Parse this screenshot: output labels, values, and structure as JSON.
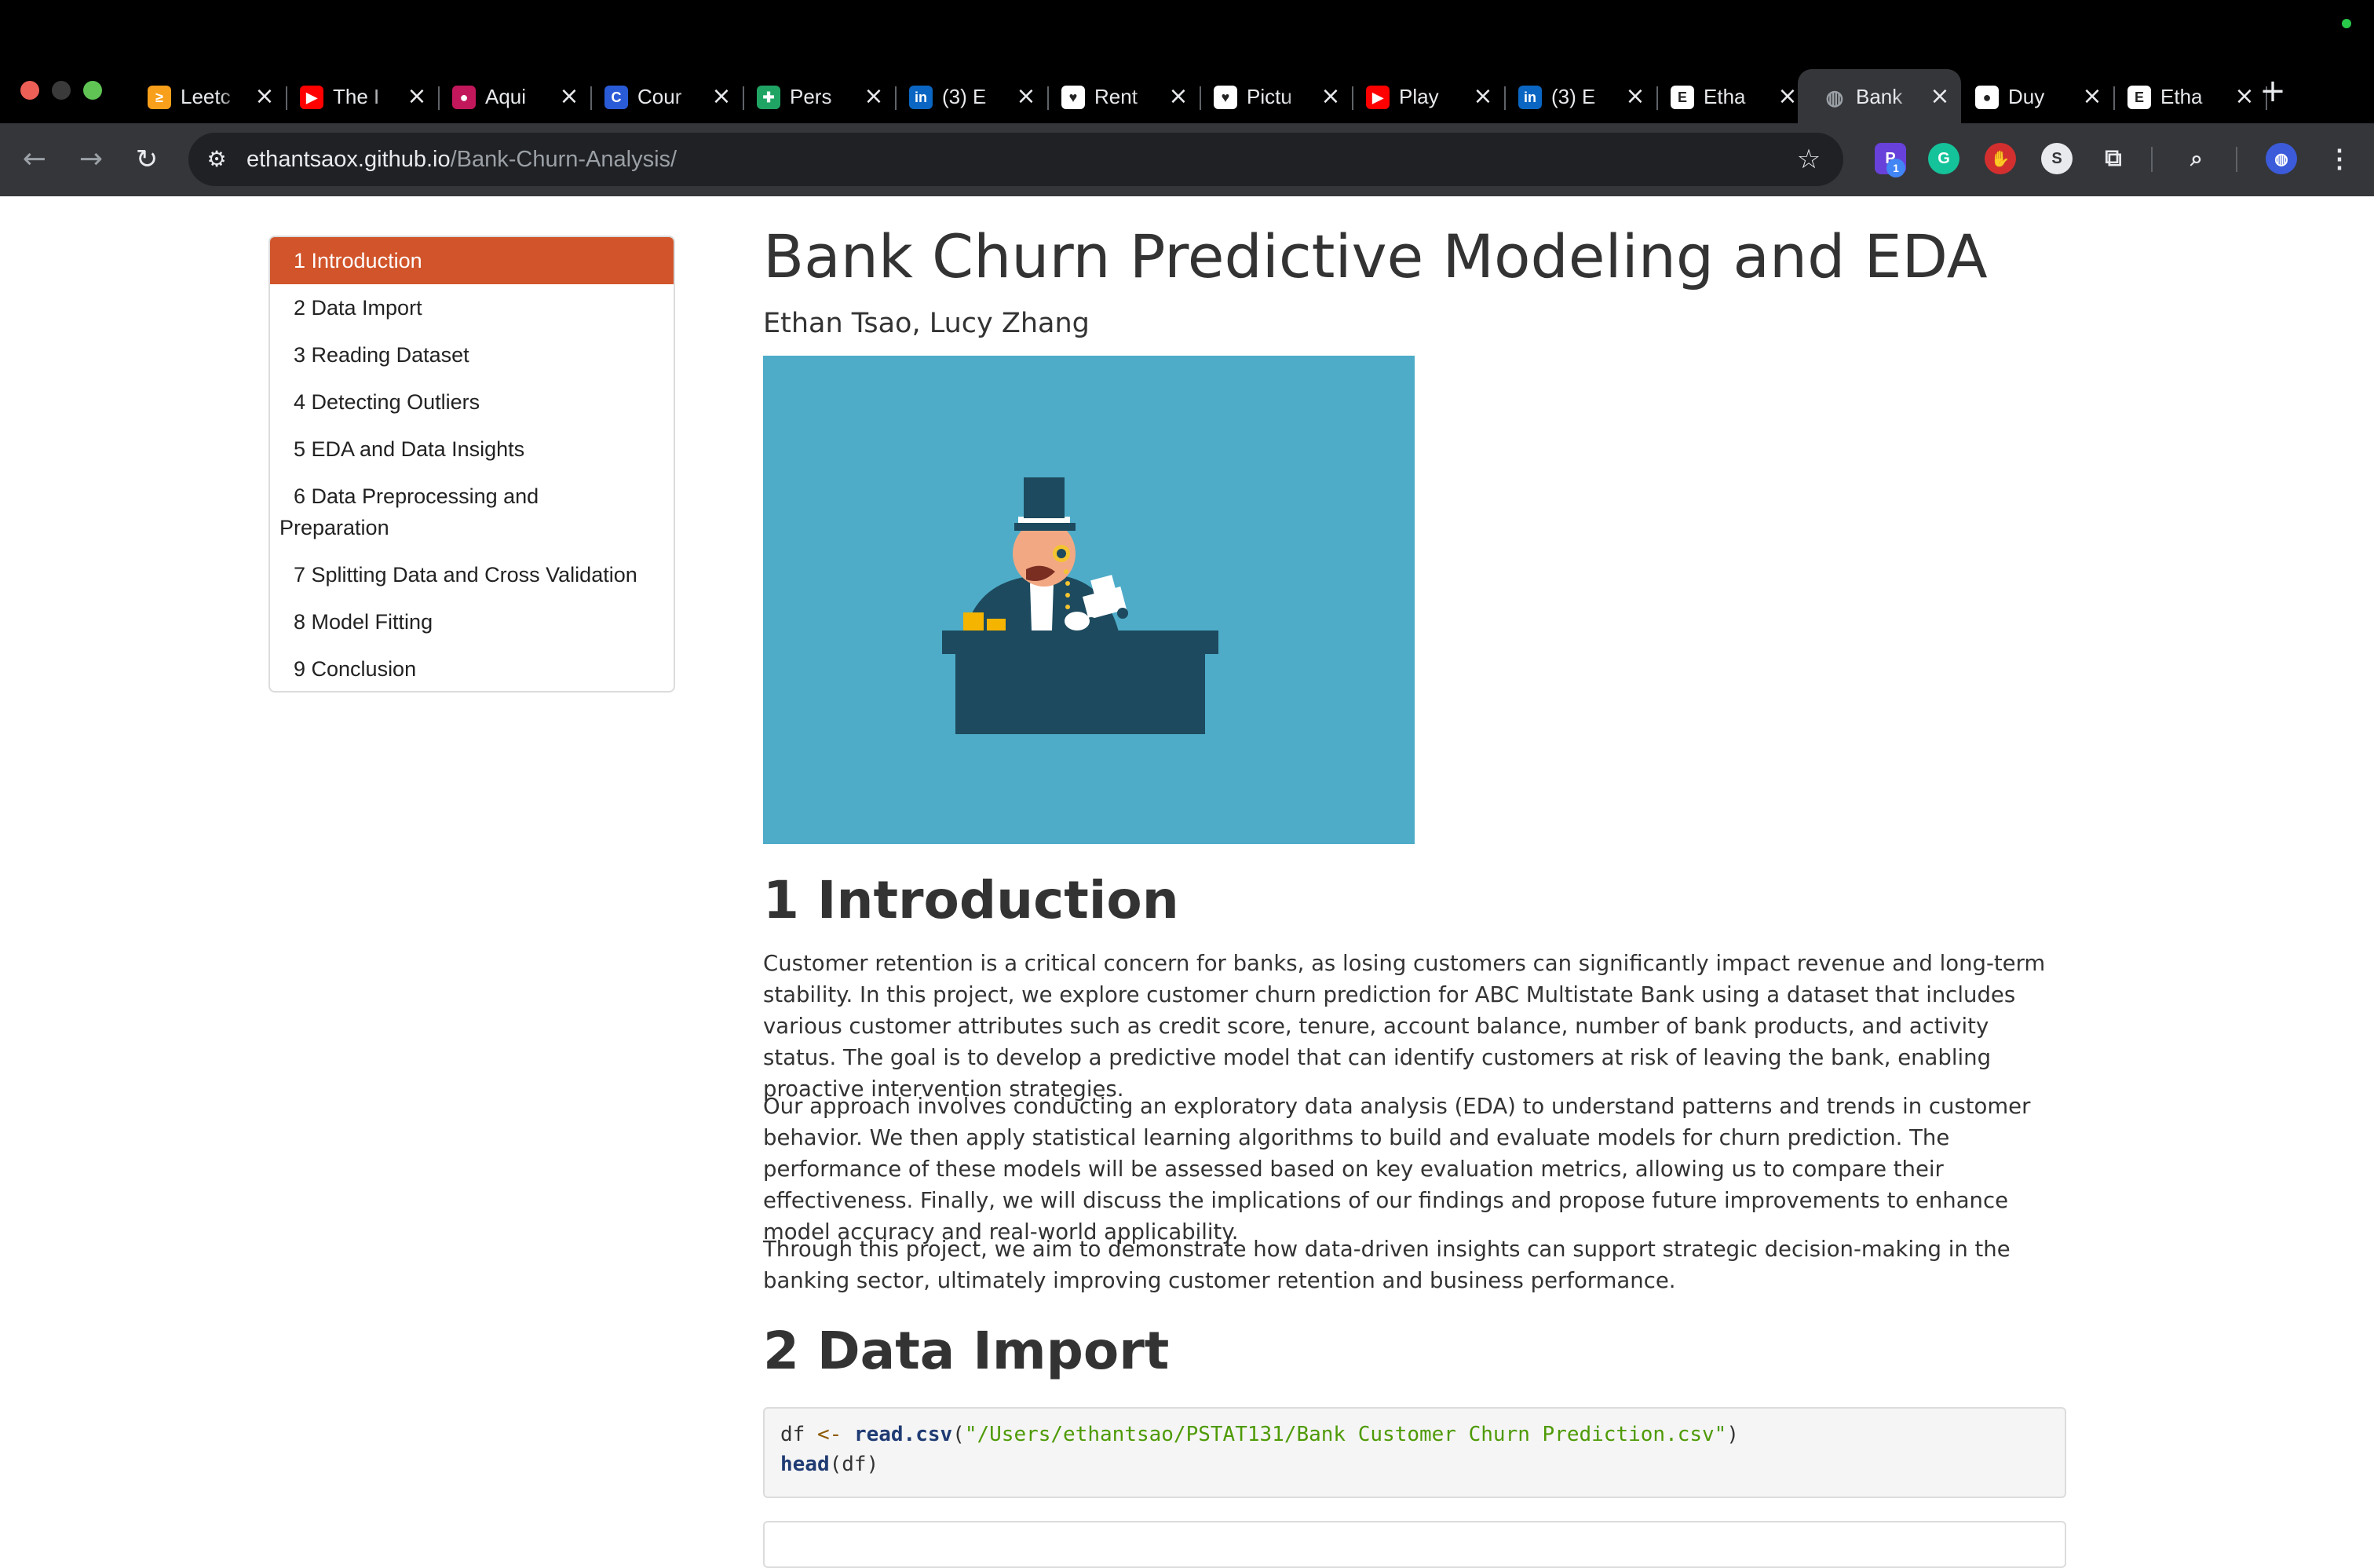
{
  "browser": {
    "tabs": [
      {
        "title": "Leetc",
        "icon": "leetcode-icon",
        "color": "#f89f1b",
        "glyph": "≥"
      },
      {
        "title": "The I",
        "icon": "youtube-icon",
        "color": "#ff0000",
        "glyph": "▶"
      },
      {
        "title": "Aqui",
        "icon": "aquila-icon",
        "color": "#c2185b",
        "glyph": "●"
      },
      {
        "title": "Cour",
        "icon": "coursera-icon",
        "color": "#2a5bd7",
        "glyph": "C"
      },
      {
        "title": "Pers",
        "icon": "sheets-icon",
        "color": "#20a464",
        "glyph": "✚"
      },
      {
        "title": "(3) E",
        "icon": "linkedin-icon",
        "color": "#0a66c2",
        "glyph": "in"
      },
      {
        "title": "Rent",
        "icon": "doc-icon",
        "color": "#ffffff",
        "glyph": "♥"
      },
      {
        "title": "Pictu",
        "icon": "doc-icon",
        "color": "#ffffff",
        "glyph": "♥"
      },
      {
        "title": "Play",
        "icon": "youtube-icon",
        "color": "#ff0000",
        "glyph": "▶"
      },
      {
        "title": "(3) E",
        "icon": "linkedin-icon",
        "color": "#0a66c2",
        "glyph": "in"
      },
      {
        "title": "Etha",
        "icon": "e-icon",
        "color": "#ffffff",
        "glyph": "E"
      },
      {
        "title": "Bank",
        "icon": "globe-icon",
        "color": "#9aa0a6",
        "glyph": "◍",
        "active": true
      },
      {
        "title": "Duy",
        "icon": "github-icon",
        "color": "#ffffff",
        "glyph": "●"
      },
      {
        "title": "Etha",
        "icon": "e-icon",
        "color": "#ffffff",
        "glyph": "E"
      }
    ],
    "url_host": "ethantsaox.github.io",
    "url_path": "/Bank-Churn-Analysis/",
    "extension_badge": "1"
  },
  "toc": {
    "items": [
      "1 Introduction",
      "2 Data Import",
      "3 Reading Dataset",
      "4 Detecting Outliers",
      "5 EDA and Data Insights",
      "6 Data Preprocessing and Preparation",
      "7 Splitting Data and Cross Validation",
      "8 Model Fitting",
      "9 Conclusion"
    ]
  },
  "page": {
    "title": "Bank Churn Predictive Modeling and EDA",
    "authors": "Ethan Tsao, Lucy Zhang",
    "intro_heading": "1 Introduction",
    "intro_p1": "Customer retention is a critical concern for banks, as losing customers can significantly impact revenue and long-term stability. In this project, we explore customer churn prediction for ABC Multistate Bank using a dataset that includes various customer attributes such as credit score, tenure, account balance, number of bank products, and activity status. The goal is to develop a predictive model that can identify customers at risk of leaving the bank, enabling proactive intervention strategies.",
    "intro_p2": "Our approach involves conducting an exploratory data analysis (EDA) to understand patterns and trends in customer behavior. We then apply statistical learning algorithms to build and evaluate models for churn prediction. The performance of these models will be assessed based on key evaluation metrics, allowing us to compare their effectiveness. Finally, we will discuss the implications of our findings and propose future improvements to enhance model accuracy and real-world applicability.",
    "intro_p3": "Through this project, we aim to demonstrate how data-driven insights can support strategic decision-making in the banking sector, ultimately improving customer retention and business performance.",
    "import_heading": "2 Data Import",
    "code": {
      "l1_var": "df",
      "l1_op": "<-",
      "l1_fn": "read.csv",
      "l1_open": "(",
      "l1_str": "\"/Users/ethantsao/PSTAT131/Bank Customer Churn Prediction.csv\"",
      "l1_close": ")",
      "l2_fn": "head",
      "l2_args": "(df)"
    }
  },
  "colors": {
    "toc_active": "#d1542a",
    "hero_bg": "#4eacc8"
  }
}
